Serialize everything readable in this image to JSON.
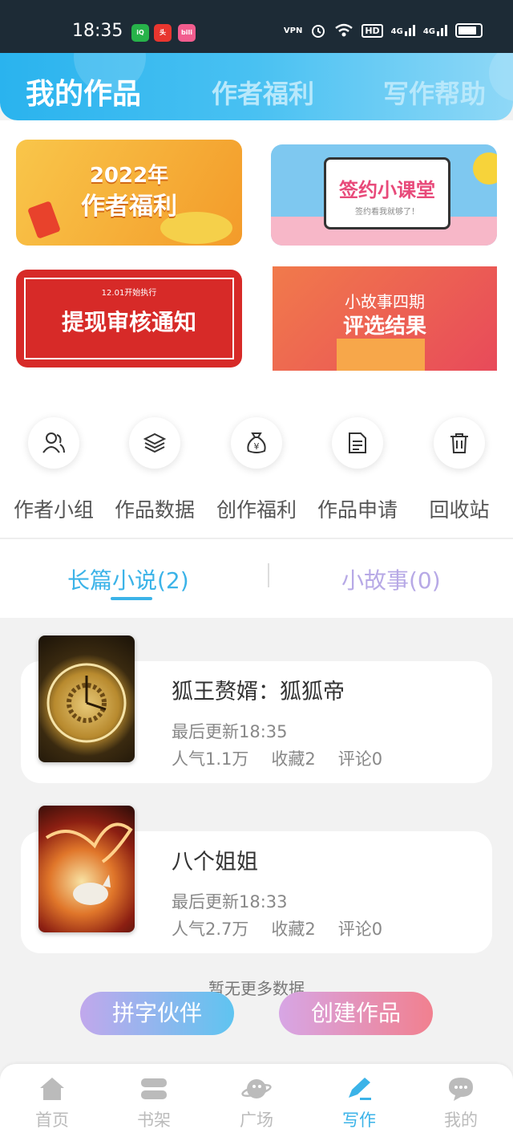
{
  "status_bar": {
    "time": "18:35",
    "apps": [
      "iqiyi",
      "头条",
      "bilibili"
    ],
    "vpn": "VPN",
    "hd": "HD",
    "net1": "4G",
    "net2": "4G"
  },
  "header": {
    "tabs": [
      {
        "label": "我的作品",
        "active": true
      },
      {
        "label": "作者福利",
        "active": false
      },
      {
        "label": "写作帮助",
        "active": false
      }
    ]
  },
  "banners": {
    "b1_line1": "2022年",
    "b1_line2": "作者福利",
    "b2_title": "签约小课堂",
    "b2_sub": "签约看我就够了！",
    "b3_small": "12.01开始执行",
    "b3_title": "提现审核通知",
    "b4_line1": "小故事四期",
    "b4_line2": "评选结果"
  },
  "shortcuts": [
    {
      "label": "作者小组",
      "icon": "group-icon"
    },
    {
      "label": "作品数据",
      "icon": "layers-icon"
    },
    {
      "label": "创作福利",
      "icon": "money-bag-icon"
    },
    {
      "label": "作品申请",
      "icon": "document-icon"
    },
    {
      "label": "回收站",
      "icon": "trash-icon"
    }
  ],
  "novel_tabs": [
    {
      "label": "长篇小说(2)",
      "active": true
    },
    {
      "label": "小故事(0)",
      "active": false
    }
  ],
  "books": [
    {
      "title": "狐王赘婿：狐狐帝",
      "updated": "最后更新18:35",
      "popularity": "人气1.1万",
      "favorites": "收藏2",
      "comments": "评论0"
    },
    {
      "title": "八个姐姐",
      "updated": "最后更新18:33",
      "popularity": "人气2.7万",
      "favorites": "收藏2",
      "comments": "评论0"
    }
  ],
  "no_more_text": "暂无更多数据",
  "fab": {
    "left_label": "拼字伙伴",
    "right_label": "创建作品"
  },
  "bottom_nav": [
    {
      "label": "首页",
      "icon": "home-icon",
      "active": false
    },
    {
      "label": "书架",
      "icon": "bookshelf-icon",
      "active": false
    },
    {
      "label": "广场",
      "icon": "planet-icon",
      "active": false
    },
    {
      "label": "写作",
      "icon": "pen-icon",
      "active": true
    },
    {
      "label": "我的",
      "icon": "chat-bubble-icon",
      "active": false
    }
  ],
  "colors": {
    "accent": "#3bb3e8",
    "header_gradient_start": "#2ab3ee",
    "inactive_tab": "#b7a9e6"
  }
}
